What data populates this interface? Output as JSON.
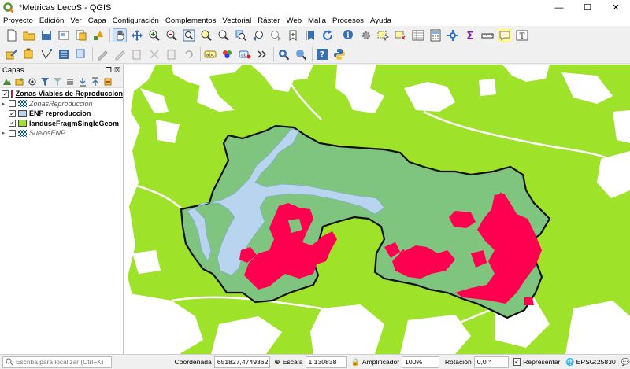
{
  "window": {
    "title": "*Metricas LecoS - QGIS",
    "minimize": "—",
    "maximize": "☐",
    "close": "✕"
  },
  "menu": [
    "Proyecto",
    "Edición",
    "Ver",
    "Capa",
    "Configuración",
    "Complementos",
    "Vectorial",
    "Ráster",
    "Web",
    "Malla",
    "Procesos",
    "Ayuda"
  ],
  "panel": {
    "title": "Capas",
    "layers": [
      {
        "name": "Zonas Viables de Reproduccion",
        "checked": true,
        "style": "bold sel",
        "color": "#ff0050",
        "kind": "fill"
      },
      {
        "name": "ZonasReproduccion",
        "checked": false,
        "style": "italic",
        "color": "",
        "kind": "raster"
      },
      {
        "name": "ENP reproduccion",
        "checked": true,
        "style": "bold",
        "color": "#b8d4ef",
        "kind": "fill"
      },
      {
        "name": "landuseFragmSingleGeom",
        "checked": true,
        "style": "bold",
        "color": "#9ee22a",
        "kind": "fill"
      },
      {
        "name": "SuelosENP",
        "checked": false,
        "style": "italic",
        "color": "",
        "kind": "raster"
      }
    ]
  },
  "status": {
    "locate_placeholder": "Escriba para localizar (Ctrl+K)",
    "coord_label": "Coordenada",
    "coord_value": "651827,4749362",
    "scale_label": "Escala",
    "scale_value": "1:130838",
    "magnifier_label": "Amplificador",
    "magnifier_value": "100%",
    "rotation_label": "Rotación",
    "rotation_value": "0,0 °",
    "render_label": "Representar",
    "crs": "EPSG:25830"
  },
  "colors": {
    "landuse": "#9ee22a",
    "enp": "#7fc47f",
    "water": "#b8d4ef",
    "zones": "#ff0050"
  },
  "icons": {
    "toolbar1": [
      "new-project-icon",
      "open-project-icon",
      "save-project-icon",
      "print-layout-icon",
      "layout-manager-icon",
      "style-manager-icon",
      "pan-icon",
      "pan-to-selection-icon",
      "zoom-in-icon",
      "zoom-out-icon",
      "zoom-full-icon",
      "zoom-selection-icon",
      "zoom-layer-icon",
      "zoom-native-icon",
      "zoom-last-icon",
      "zoom-next-icon",
      "new-bookmark-icon",
      "show-bookmarks-icon",
      "refresh-icon",
      "identify-icon",
      "action-icon",
      "select-icon",
      "deselect-icon",
      "attribute-table-icon",
      "field-calc-icon",
      "stats-icon",
      "sum-icon",
      "measure-icon",
      "tips-icon",
      "text-annotation-icon"
    ],
    "toolbar2": [
      "digitize-icon",
      "editing-icon",
      "vertex-icon",
      "save-edits-icon",
      "add-feature-icon",
      "delete-icon",
      "cut-icon",
      "copy-icon",
      "paste-icon",
      "undo-icon",
      "redo-icon",
      "label-icon",
      "label-pin-icon",
      "label-move-icon",
      "more-icon",
      "metasearch-icon",
      "plugin-icon",
      "help-icon",
      "python-icon"
    ]
  }
}
